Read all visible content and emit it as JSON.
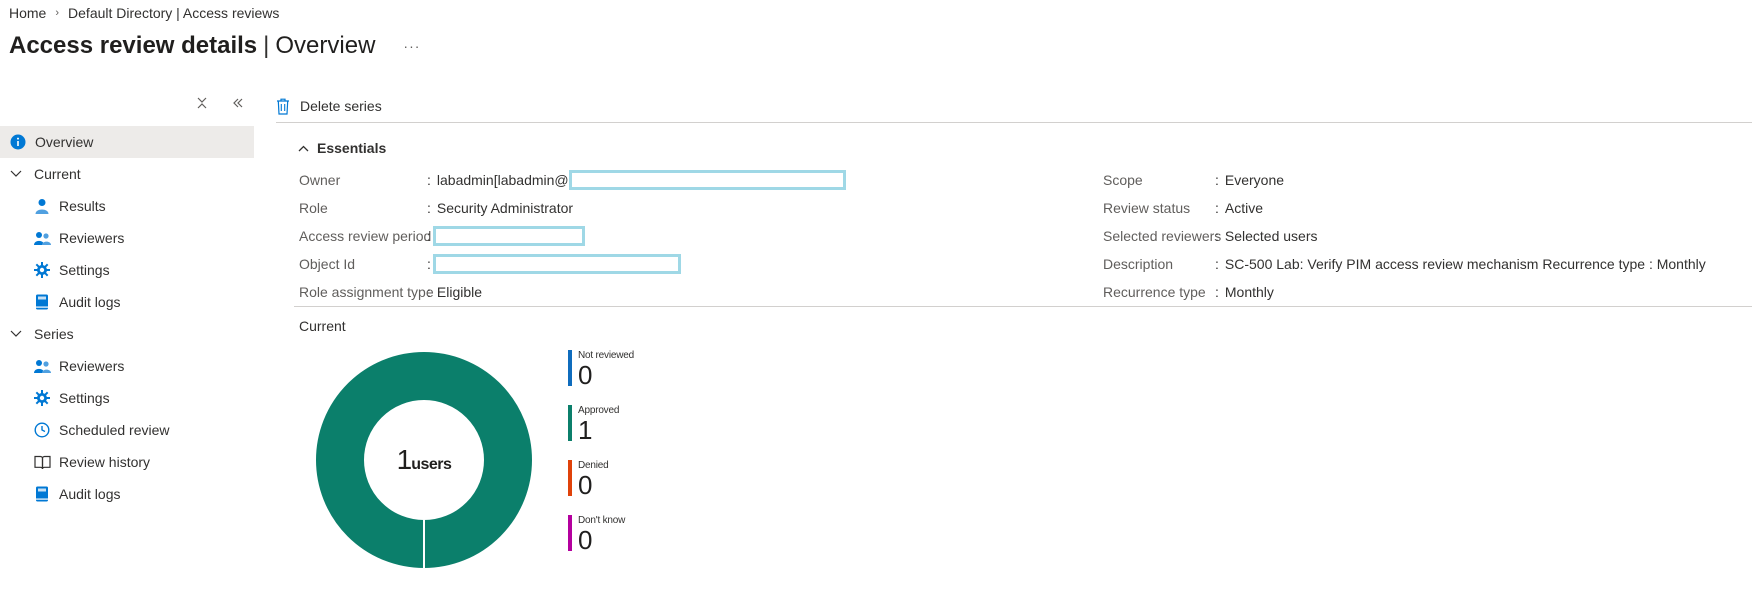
{
  "breadcrumb": {
    "home": "Home",
    "directory": "Default Directory | Access reviews"
  },
  "header": {
    "title_main": "Access review details",
    "title_sep": "|",
    "title_sub": "Overview",
    "more": "···"
  },
  "sidebar": {
    "overview": "Overview",
    "current_group": "Current",
    "current_items": [
      "Results",
      "Reviewers",
      "Settings",
      "Audit logs"
    ],
    "series_group": "Series",
    "series_items": [
      "Reviewers",
      "Settings",
      "Scheduled review",
      "Review history",
      "Audit logs"
    ]
  },
  "toolbar": {
    "delete_series": "Delete series"
  },
  "essentials": {
    "heading": "Essentials",
    "left": [
      {
        "label": "Owner",
        "value": "labadmin[labadmin@"
      },
      {
        "label": "Role",
        "value": "Security Administrator"
      },
      {
        "label": "Access review period",
        "value": ""
      },
      {
        "label": "Object Id",
        "value": ""
      },
      {
        "label": "Role assignment type",
        "value": "Eligible"
      }
    ],
    "right": [
      {
        "label": "Scope",
        "value": "Everyone"
      },
      {
        "label": "Review status",
        "value": "Active"
      },
      {
        "label": "Selected reviewers",
        "value": "Selected users"
      },
      {
        "label": "Description",
        "value": "SC-500 Lab: Verify PIM access review mechanism Recurrence type : Monthly"
      },
      {
        "label": "Recurrence type",
        "value": "Monthly"
      }
    ]
  },
  "current": {
    "label": "Current",
    "total": "1",
    "unit": "users",
    "legend": [
      {
        "label": "Not reviewed",
        "count": "0",
        "color": "#0f6cbd"
      },
      {
        "label": "Approved",
        "count": "1",
        "color": "#0b7f6b"
      },
      {
        "label": "Denied",
        "count": "0",
        "color": "#e0420a"
      },
      {
        "label": "Don't know",
        "count": "0",
        "color": "#b4009e"
      }
    ]
  },
  "colors": {
    "accent": "#0078d4",
    "approved": "#0b7f6b",
    "redaction": "#9fd8e6"
  }
}
